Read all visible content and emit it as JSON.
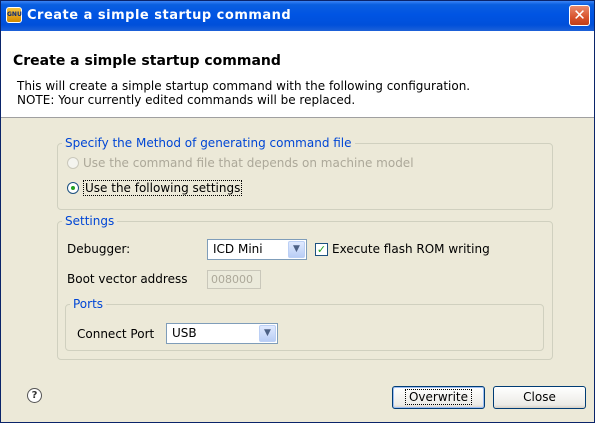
{
  "window": {
    "title": "Create a simple startup command",
    "app_icon_text": "GNU",
    "close_glyph": "✕"
  },
  "header": {
    "title": "Create a simple startup command",
    "line1": "This will create a simple startup command with the following configuration.",
    "line2": "NOTE: Your currently edited commands will be replaced."
  },
  "method_group": {
    "legend": "Specify the Method of generating command file",
    "option_model": {
      "label": "Use the command file that depends on machine model",
      "checked": false,
      "enabled": false
    },
    "option_settings": {
      "label": "Use the following settings",
      "checked": true,
      "enabled": true
    }
  },
  "settings_group": {
    "legend": "Settings",
    "debugger_label": "Debugger:",
    "debugger_value": "ICD Mini",
    "flash_checkbox_label": "Execute flash ROM writing",
    "flash_checked": true,
    "boot_vector_label": "Boot vector address",
    "boot_vector_value": "008000"
  },
  "ports_group": {
    "legend": "Ports",
    "connect_port_label": "Connect Port",
    "connect_port_value": "USB"
  },
  "footer": {
    "help_glyph": "?",
    "overwrite_label": "Overwrite",
    "close_label": "Close"
  }
}
